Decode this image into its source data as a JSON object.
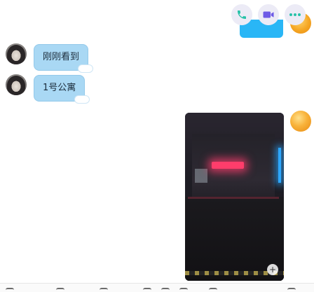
{
  "header_actions": [
    {
      "icon": "phone-icon",
      "color": "#27c2a8"
    },
    {
      "icon": "video-call-icon",
      "color": "#6d5ae6"
    },
    {
      "icon": "more-icon",
      "color": "#27c2a8"
    }
  ],
  "messages": [
    {
      "sender": "contact",
      "text": "刚刚看到"
    },
    {
      "sender": "contact",
      "text": "1号公寓"
    }
  ],
  "video_message": {
    "sender": "me",
    "badge": "+"
  }
}
